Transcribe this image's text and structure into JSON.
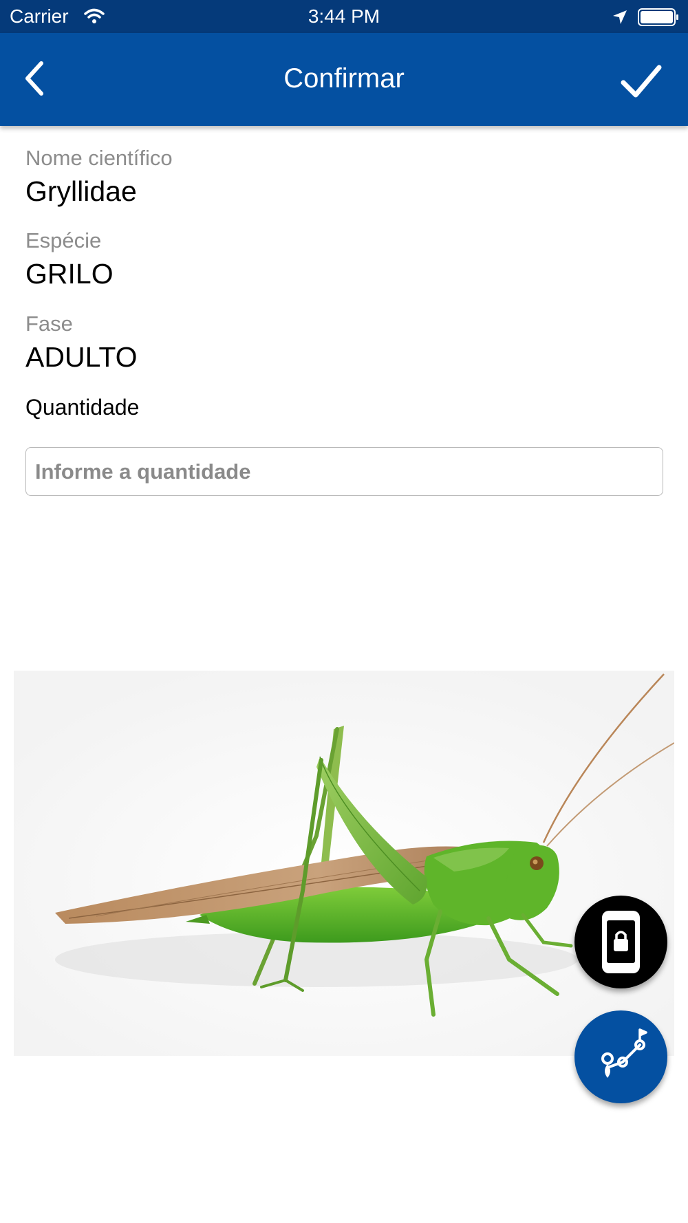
{
  "status_bar": {
    "carrier": "Carrier",
    "time": "3:44 PM"
  },
  "nav": {
    "title": "Confirmar"
  },
  "fields": {
    "scientific_name_label": "Nome científico",
    "scientific_name_value": "Gryllidae",
    "species_label": "Espécie",
    "species_value": "GRILO",
    "phase_label": "Fase",
    "phase_value": "ADULTO"
  },
  "quantity": {
    "label": "Quantidade",
    "placeholder": "Informe a quantidade",
    "value": ""
  },
  "icons": {
    "back": "chevron-left-icon",
    "confirm": "checkmark-icon",
    "lock": "phone-lock-icon",
    "route": "route-icon"
  },
  "colors": {
    "status_bar": "#053a7a",
    "nav_bar": "#0450a1",
    "fab_lock": "#000000",
    "fab_route": "#0450a1"
  }
}
